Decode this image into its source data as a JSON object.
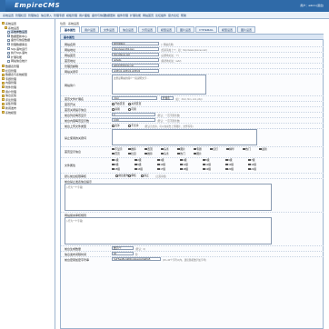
{
  "header": {
    "logo": "EmpireCMS",
    "user": "用户：admin [退出]"
  },
  "nav": [
    "系统设置",
    "管理栏目",
    "管理信息",
    "信息录入",
    "管理专题",
    "模板管理",
    "用户面板",
    "备份与恢复",
    "数据更新",
    "插件管理",
    "扩展功能",
    "网站首页",
    "论坛插件",
    "官方论坛",
    "帮助"
  ],
  "sidebar": {
    "items": [
      {
        "label": "系统设置",
        "icon": "folder-icon",
        "indent": 0
      },
      {
        "label": "系统设置",
        "icon": "folder-icon",
        "indent": 1
      },
      {
        "label": "系统参数设置",
        "icon": "page-icon",
        "indent": 2,
        "selected": true
      },
      {
        "label": "数据更新中心",
        "icon": "page-icon",
        "indent": 2
      },
      {
        "label": "备份与恢复数据",
        "icon": "page-icon",
        "indent": 2
      },
      {
        "label": "管理数据库表",
        "icon": "page-icon",
        "indent": 2
      },
      {
        "label": "SQL语句运行",
        "icon": "page-icon",
        "indent": 2
      },
      {
        "label": "执行SQL语句",
        "icon": "page-icon",
        "indent": 2
      },
      {
        "label": "扩展功能",
        "icon": "page-icon",
        "indent": 2
      },
      {
        "label": "网站信息统计",
        "icon": "page-icon",
        "indent": 2
      },
      {
        "label": "数据表管理",
        "icon": "folder-icon",
        "indent": 0
      },
      {
        "label": "栏目管理",
        "icon": "folder-icon",
        "indent": 0
      },
      {
        "label": "数据表与系统模型",
        "icon": "folder-icon",
        "indent": 0
      },
      {
        "label": "专题管理",
        "icon": "folder-icon",
        "indent": 0
      },
      {
        "label": "内容管理",
        "icon": "folder-icon",
        "indent": 0
      },
      {
        "label": "附件管理",
        "icon": "folder-icon",
        "indent": 0
      },
      {
        "label": "用户管理",
        "icon": "folder-icon",
        "indent": 0
      },
      {
        "label": "信息反馈",
        "icon": "folder-icon",
        "indent": 0
      },
      {
        "label": "评论管理",
        "icon": "folder-icon",
        "indent": 0
      },
      {
        "label": "采集管理",
        "icon": "folder-icon",
        "indent": 0
      },
      {
        "label": "新闻发布",
        "icon": "folder-icon",
        "indent": 0
      },
      {
        "label": "系统模型",
        "icon": "folder-icon",
        "indent": 0
      }
    ]
  },
  "crumb": "位置：系统设置",
  "tabs": [
    "基本属性",
    "用户设置",
    "文件设置",
    "信息设置",
    "分页设置",
    "模型设置",
    "图片设置",
    "FTP/EMAIL",
    "模型设置",
    "图片设置"
  ],
  "form": {
    "section": "基本属性",
    "rows": [
      {
        "label": "网站名称",
        "value": "我的网站名",
        "note": "(↑ 网站名称)",
        "kind": "input"
      },
      {
        "label": "网站地址",
        "value": "http://www.163.com",
        "note": "(结尾请加上\"/\"，如：http://www.phome.net/)",
        "kind": "input"
      },
      {
        "label": "网站首页",
        "value": "http://demo.net/",
        "note": "(完整地址如：\"/\")",
        "kind": "input"
      },
      {
        "label": "首页地址",
        "value": "/a/hello",
        "note": "(路径地址如：/a/b/)",
        "kind": "input"
      },
      {
        "label": "管理员邮箱",
        "value": "admin@phome.net",
        "note": "",
        "kind": "input"
      },
      {
        "label": "网站关键字",
        "value": "关键词1,关键词2,关键词3",
        "note": "",
        "kind": "input"
      }
    ],
    "desc_label": "网站简介",
    "desc_value": "这里是网站的简介一段说明文字...",
    "ext_label": "首页文件扩展名",
    "ext_value": ".html",
    "ext_note": "(如：.html,.htm,.xml,.php)",
    "ext_select": "扩展名",
    "open_label": "首页开关",
    "open_opts": [
      "开启首页",
      "关闭首页"
    ],
    "close_label": "首页关闭提示信息",
    "close_opts": [
      "禁用",
      "可用"
    ],
    "list_label": "前台列表每页显示",
    "list_value": "0",
    "list_note": "(默认：一页不限条数)",
    "list2_label": "前台内容每页显示数",
    "list2_value": "1000",
    "list2_note": "(默认：一页不限条数)",
    "upload_label": "前台上传文件类型",
    "upload_opts": [
      "允许",
      "不允许"
    ],
    "upload_note": "(默认为允许，可以在前台上传图片、文件等等)",
    "ban_label": "禁止使用的关键词",
    "ban_value": "",
    "feature_label": "首页显示信息",
    "feature_opts": [
      {
        "label": "不显示",
        "on": false
      },
      {
        "label": "推荐",
        "on": true
      },
      {
        "label": "置顶",
        "on": false
      },
      {
        "label": "头条",
        "on": false
      },
      {
        "label": "图片",
        "on": false
      },
      {
        "label": "专题",
        "on": false
      },
      {
        "label": "幻灯",
        "on": false
      },
      {
        "label": "精华",
        "on": true
      },
      {
        "label": "热门",
        "on": false
      },
      {
        "label": "最新",
        "on": true
      },
      {
        "label": "首页",
        "on": true
      },
      {
        "label": "栏目",
        "on": false
      },
      {
        "label": "推荐",
        "on": true
      },
      {
        "label": "头条",
        "on": false
      },
      {
        "label": "热门",
        "on": true
      },
      {
        "label": "图片",
        "on": true
      }
    ],
    "level_label": "文件属性",
    "level_opts": [
      {
        "label": "1级",
        "on": false
      },
      {
        "label": "2级",
        "on": true
      },
      {
        "label": "3级",
        "on": false
      },
      {
        "label": "4级",
        "on": false
      },
      {
        "label": "5级",
        "on": false
      },
      {
        "label": "6级",
        "on": true
      },
      {
        "label": "7级",
        "on": false
      },
      {
        "label": "8级",
        "on": false
      },
      {
        "label": "9级",
        "on": false
      },
      {
        "label": "10级",
        "on": false
      },
      {
        "label": "11级",
        "on": false
      },
      {
        "label": "12级",
        "on": false
      },
      {
        "label": "13级",
        "on": false
      },
      {
        "label": "14级",
        "on": false
      },
      {
        "label": "15级",
        "on": false
      },
      {
        "label": "16级",
        "on": false
      },
      {
        "label": "17级",
        "on": false
      },
      {
        "label": "18级",
        "on": false
      },
      {
        "label": "19级",
        "on": false
      },
      {
        "label": "20级",
        "on": false
      },
      {
        "label": "21级",
        "on": false
      }
    ],
    "pub_label": "默认前台权限审核",
    "pub_opts": [
      "前台发布",
      "审核",
      "禁止"
    ],
    "pub_hint": "(无需审核)",
    "notice_label": "前台禁止发表信息提示",
    "notice_value": "(-行为一个字段)",
    "cnotice_label": "网站留言审核规则",
    "cnotice_value": "(-行为一个字段)",
    "gen_label": "前台生成数量",
    "gen_value": "数字/个",
    "gen_note": "(默认：0)",
    "time_label": "信息发布间隔时间",
    "time_value": "30",
    "time_note": "秒",
    "key_label": "前台密钥加密字符串",
    "key_value": "hsZTsesBunjkDjbg1dussGjQaRGj5",
    "key_note": "(15~40个字符以内，建议随机数字加字母)"
  }
}
